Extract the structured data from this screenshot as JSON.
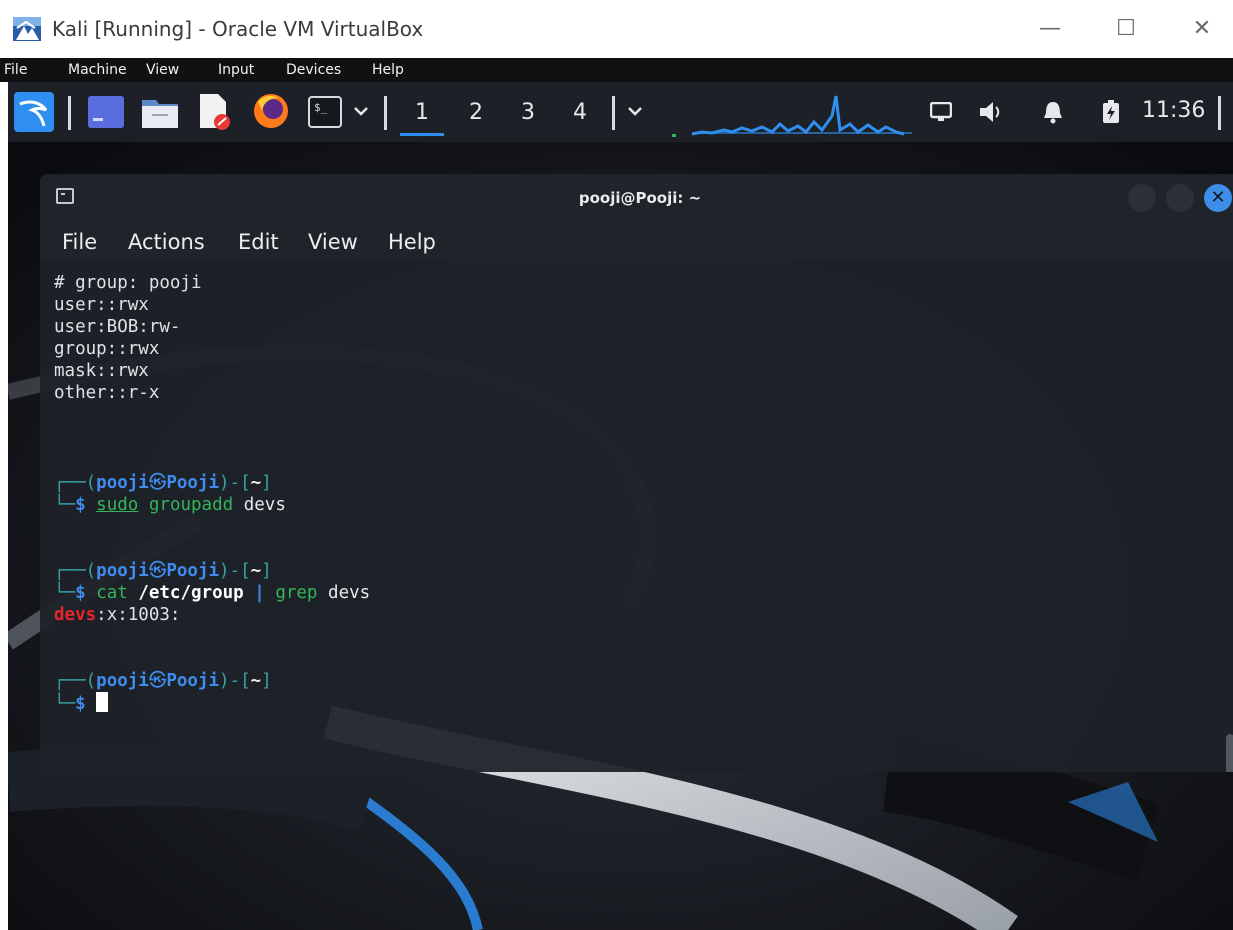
{
  "window": {
    "title": "Kali [Running] - Oracle VM VirtualBox",
    "controls": {
      "minimize": "—",
      "maximize": "☐",
      "close": "✕"
    }
  },
  "host_menu": [
    "File",
    "Machine",
    "View",
    "Input",
    "Devices",
    "Help"
  ],
  "panel": {
    "workspaces": [
      "1",
      "2",
      "3",
      "4"
    ],
    "active_workspace": "1",
    "clock": "11:36",
    "icons": [
      "kali-menu-icon",
      "show-desktop-icon",
      "file-manager-icon",
      "text-editor-icon",
      "firefox-icon",
      "terminal-icon",
      "chevron-down-icon",
      "network-icon",
      "volume-icon",
      "notification-bell-icon",
      "battery-icon"
    ]
  },
  "terminal": {
    "title": "pooji@Pooji: ~",
    "menu": [
      "File",
      "Actions",
      "Edit",
      "View",
      "Help"
    ],
    "acl_lines": [
      "# group: pooji",
      "user::rwx",
      "user:BOB:rw-",
      "group::rwx",
      "mask::rwx",
      "other::r-x"
    ],
    "prompt": {
      "open": "┌──(",
      "user": "pooji",
      "at": "㉿",
      "host": "Pooji",
      "mid": ")-[",
      "path": "~",
      "close": "]",
      "end": "└─",
      "dollar": "$"
    },
    "commands": [
      {
        "cmd": "sudo",
        "args": "groupadd devs",
        "output": ""
      },
      {
        "cmd": "cat",
        "arg_bold": "/etc/group",
        "pipe": "|",
        "cmd2": "grep",
        "args2": "devs",
        "output_match": "devs",
        "output_rest": ":x:1003:"
      }
    ]
  },
  "colors": {
    "accent": "#3f8cf0",
    "prompt_frame": "#3aa0a8",
    "command": "#34b45b",
    "grep_match": "#e6262d",
    "panel_bg": "#1d2026",
    "terminal_bg": "#1e2228"
  }
}
